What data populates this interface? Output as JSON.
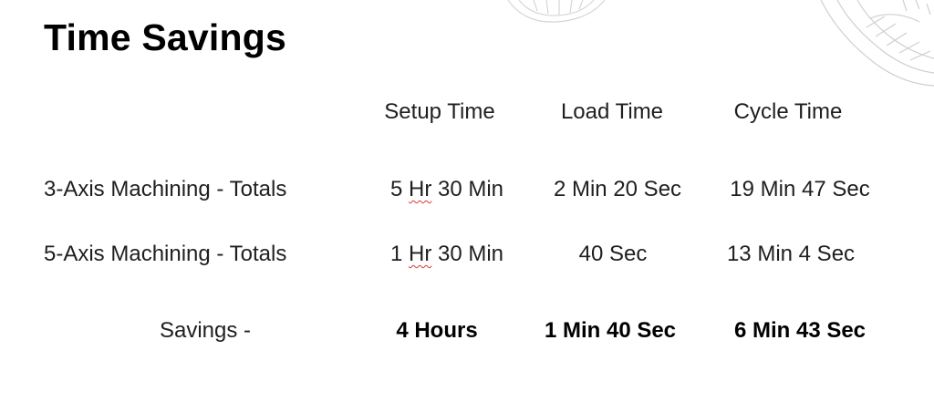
{
  "title": "Time Savings",
  "columns": [
    "Setup Time",
    "Load Time",
    "Cycle Time"
  ],
  "rows": [
    {
      "label": "3-Axis Machining - Totals",
      "setup_hr_value": "5",
      "setup_hr_unit": "Hr",
      "setup_min": "30 Min",
      "load": "2 Min 20 Sec",
      "cycle": "19 Min 47 Sec"
    },
    {
      "label": "5-Axis Machining - Totals",
      "setup_hr_value": "1",
      "setup_hr_unit": "Hr",
      "setup_min": "30 Min",
      "load": "40 Sec",
      "cycle": "13 Min 4 Sec"
    }
  ],
  "savings": {
    "label": "Savings -",
    "setup": "4 Hours",
    "load": "1 Min 40 Sec",
    "cycle": "6 Min 43 Sec"
  },
  "colors": {
    "spellcheck_underline": "#d23b3b",
    "decoration_stroke": "#c8c8c8"
  }
}
